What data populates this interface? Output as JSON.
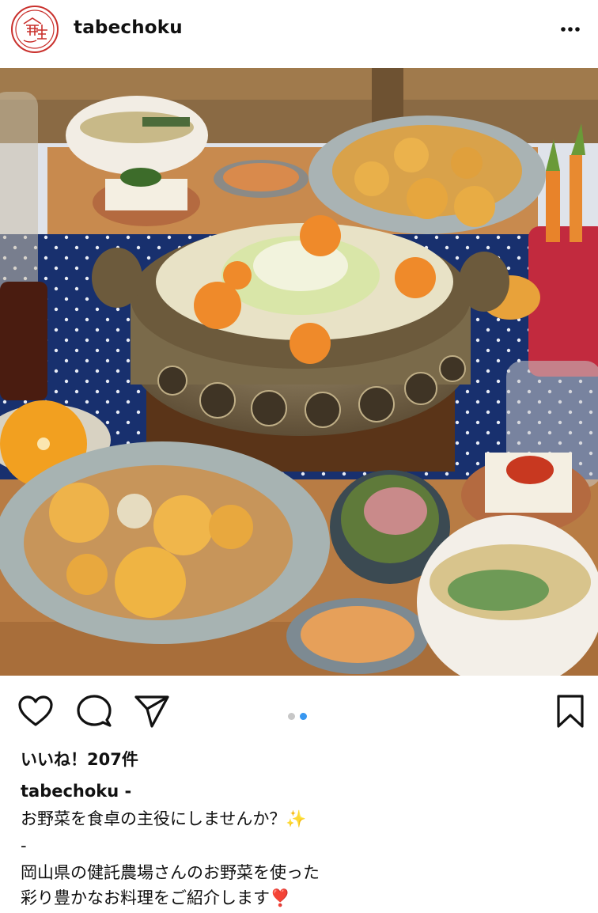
{
  "post": {
    "username": "tabechoku",
    "avatar_logo_text": "食直",
    "more_icon": "more-horizontal-icon",
    "carousel": {
      "total": 2,
      "active": 2
    },
    "likes_text": "いいね！207件",
    "caption": {
      "username": "tabechoku -",
      "line1": "お野菜を食卓の主役にしませんか？✨",
      "line2": "-",
      "line3": "岡山県の健託農場さんのお野菜を使った",
      "line4": "彩り豊かなお料理をご紹介します❣️"
    }
  },
  "colors": {
    "brand_red": "#c9302c",
    "active_dot": "#3897f0",
    "inactive_dot": "#c7c7c7"
  },
  "icons": {
    "like": "heart-icon",
    "comment": "comment-icon",
    "share": "paper-plane-icon",
    "save": "bookmark-icon"
  }
}
